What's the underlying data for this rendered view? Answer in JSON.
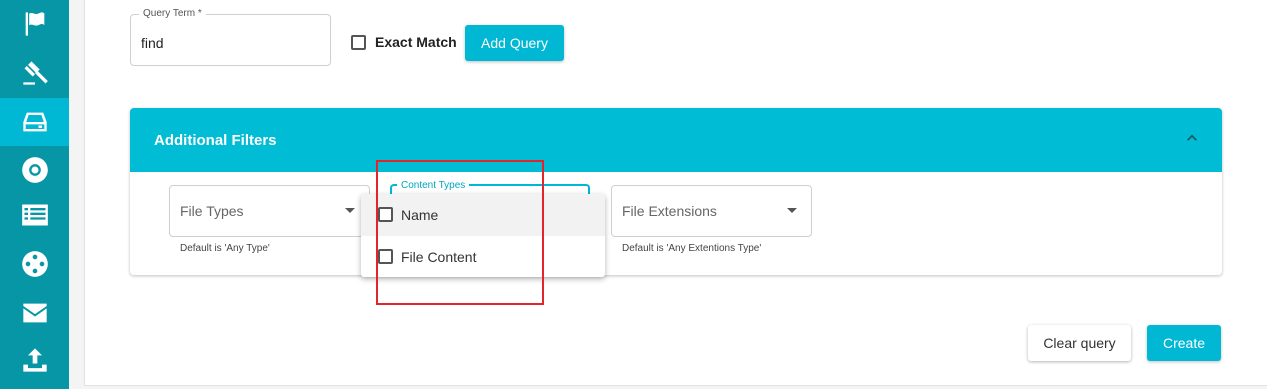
{
  "sidebar": {
    "items": [
      {
        "icon": "flag-icon"
      },
      {
        "icon": "gavel-icon"
      },
      {
        "icon": "hard-drive-icon",
        "active": true
      },
      {
        "icon": "lifebuoy-icon"
      },
      {
        "icon": "list-icon"
      },
      {
        "icon": "film-reel-icon"
      },
      {
        "icon": "envelope-icon"
      },
      {
        "icon": "upload-icon"
      }
    ]
  },
  "query": {
    "term_label": "Query Term *",
    "term_value": "find",
    "exact_match_label": "Exact Match",
    "exact_match_checked": false,
    "add_query_label": "Add Query"
  },
  "filters": {
    "title": "Additional Filters",
    "expanded": true,
    "file_types": {
      "placeholder": "File Types",
      "helper": "Default is 'Any Type'"
    },
    "content_types": {
      "label": "Content Types",
      "options": [
        {
          "label": "Name",
          "checked": false
        },
        {
          "label": "File Content",
          "checked": false
        }
      ]
    },
    "file_extensions": {
      "placeholder": "File Extensions",
      "helper": "Default is 'Any Extentions Type'"
    }
  },
  "actions": {
    "clear_label": "Clear query",
    "create_label": "Create"
  },
  "colors": {
    "sidebar": "#0696a6",
    "accent": "#00bcd4",
    "highlight": "#e0262b"
  }
}
